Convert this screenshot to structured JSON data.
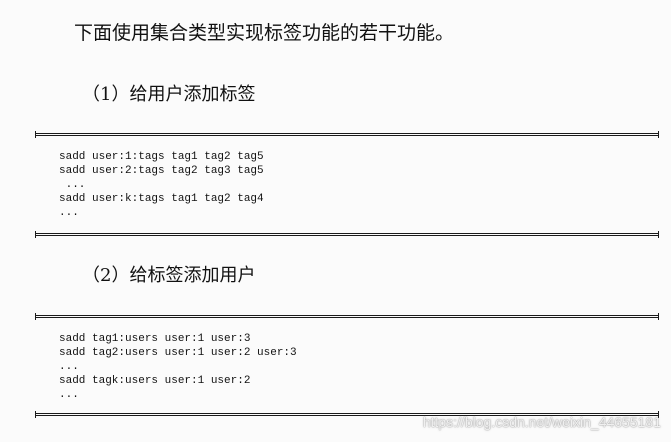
{
  "intro": "下面使用集合类型实现标签功能的若干功能。",
  "sections": [
    {
      "heading": "（1）给用户添加标签",
      "code": [
        "sadd user:1:tags tag1 tag2 tag5",
        "sadd user:2:tags tag2 tag3 tag5",
        " ...",
        "sadd user:k:tags tag1 tag2 tag4",
        "..."
      ]
    },
    {
      "heading": "（2）给标签添加用户",
      "code": [
        "sadd tag1:users user:1 user:3",
        "sadd tag2:users user:1 user:2 user:3",
        "...",
        "sadd tagk:users user:1 user:2",
        "..."
      ]
    }
  ],
  "watermark": "https://blog.csdn.net/weixin_44655181"
}
